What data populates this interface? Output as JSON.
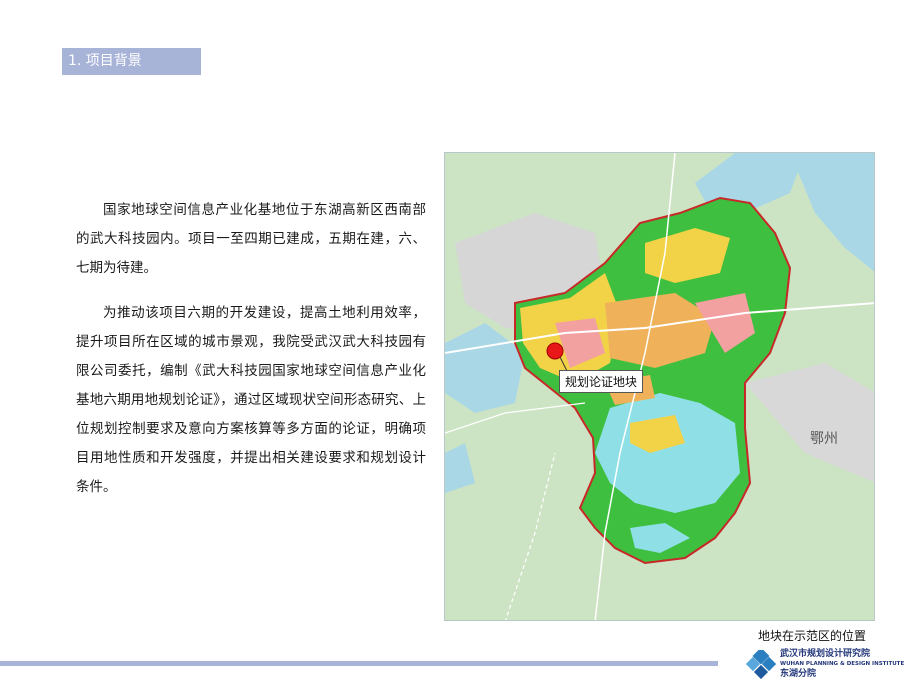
{
  "section_title": "1. 项目背景",
  "paragraphs": [
    "国家地球空间信息产业化基地位于东湖高新区西南部的武大科技园内。项目一至四期已建成，五期在建，六、七期为待建。",
    "为推动该项目六期的开发建设，提高土地利用效率，提升项目所在区域的城市景观，我院受武汉武大科技园有限公司委托，编制《武大科技园国家地球空间信息产业化基地六期用地规划论证》，通过区域现状空间形态研究、上位规划控制要求及意向方案核算等多方面的论证，明确项目用地性质和开发强度，并提出相关建设要求和规划设计条件。"
  ],
  "map": {
    "callout_label": "规划论证地块",
    "place_label": "鄂州",
    "marker_color": "#e81818"
  },
  "caption": "地块在示范区的位置",
  "logo": {
    "name_cn": "武汉市规划设计研究院",
    "name_en": "WUHAN PLANNING & DESIGN INSTITUTE",
    "branch": "东湖分院"
  }
}
